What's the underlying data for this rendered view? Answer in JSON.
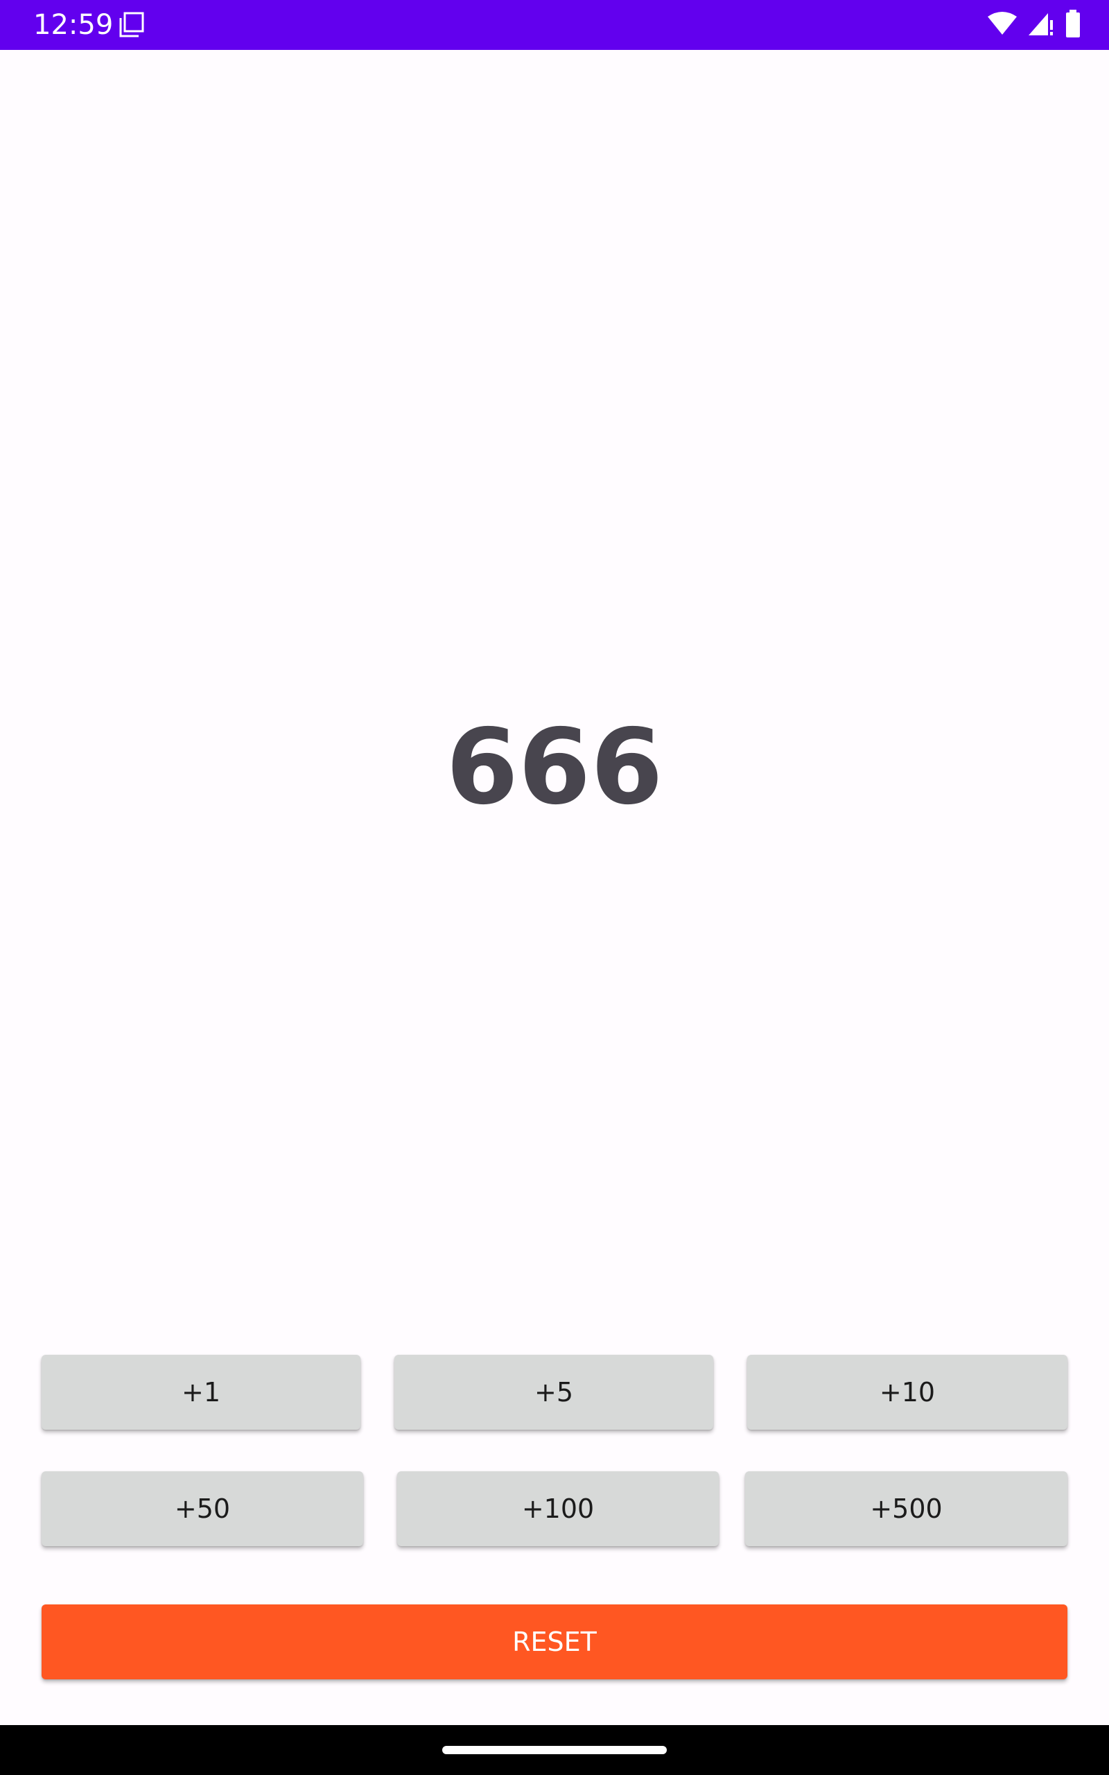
{
  "status_bar": {
    "time": "12:59",
    "background_color": "#6200ee",
    "icons": [
      "screenshot-icon",
      "wifi-icon",
      "signal-icon",
      "battery-icon"
    ]
  },
  "counter": {
    "value": "666",
    "color": "#48454e"
  },
  "buttons": {
    "row1": [
      "+1",
      "+5",
      "+10"
    ],
    "row2": [
      "+50",
      "+100",
      "+500"
    ],
    "color": "#d7d9d8"
  },
  "reset": {
    "label": "RESET",
    "color": "#ff5722"
  }
}
